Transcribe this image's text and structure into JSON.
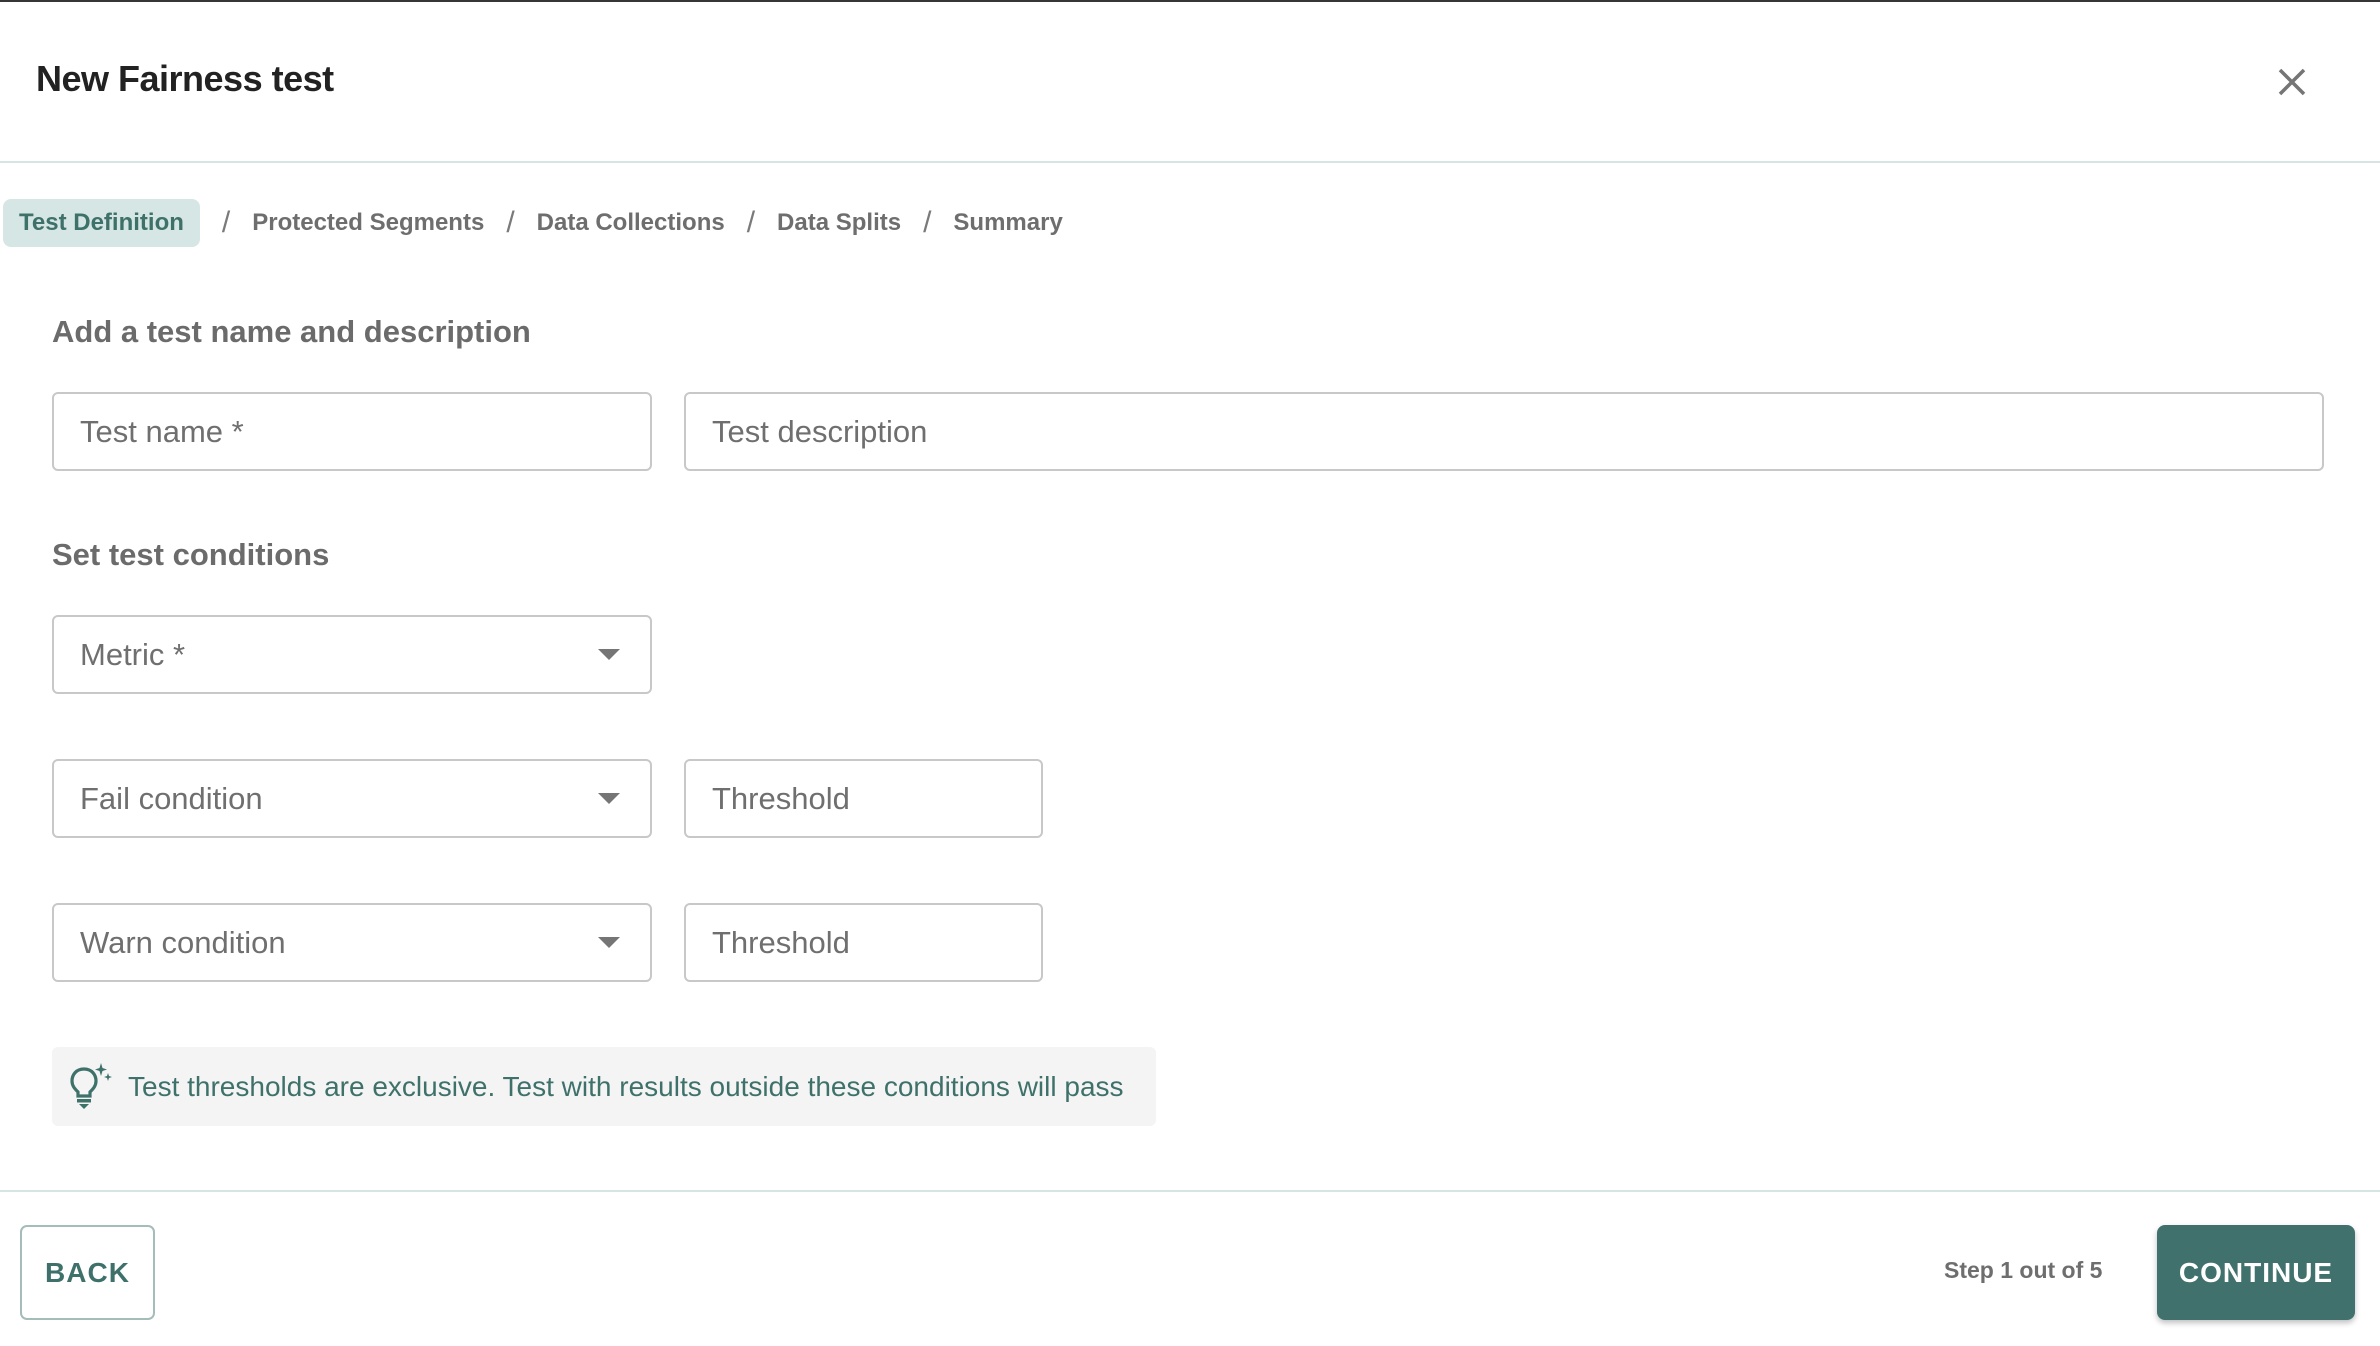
{
  "dialog": {
    "title": "New Fairness test",
    "close_icon": "close-icon"
  },
  "breadcrumb": {
    "steps": [
      {
        "label": "Test Definition",
        "active": true
      },
      {
        "label": "Protected Segments",
        "active": false
      },
      {
        "label": "Data Collections",
        "active": false
      },
      {
        "label": "Data Splits",
        "active": false
      },
      {
        "label": "Summary",
        "active": false
      }
    ],
    "separator": "/"
  },
  "sections": {
    "name_description": {
      "label": "Add a test name and description",
      "test_name": {
        "placeholder": "Test name *",
        "value": ""
      },
      "test_description": {
        "placeholder": "Test description",
        "value": ""
      }
    },
    "conditions": {
      "label": "Set test conditions",
      "metric": {
        "placeholder": "Metric *",
        "value": ""
      },
      "fail_condition": {
        "placeholder": "Fail condition",
        "value": ""
      },
      "fail_threshold": {
        "placeholder": "Threshold",
        "value": ""
      },
      "warn_condition": {
        "placeholder": "Warn condition",
        "value": ""
      },
      "warn_threshold": {
        "placeholder": "Threshold",
        "value": ""
      }
    }
  },
  "info": {
    "icon": "lightbulb-sparkle-icon",
    "text": "Test thresholds are exclusive. Test with results outside these conditions will pass"
  },
  "footer": {
    "back_label": "BACK",
    "step_text": "Step 1 out of 5",
    "continue_label": "CONTINUE"
  },
  "colors": {
    "accent": "#41716c",
    "active_tab_bg": "#d6e6e4",
    "info_bg": "#f4f4f4",
    "divider": "#d6e4e4"
  }
}
